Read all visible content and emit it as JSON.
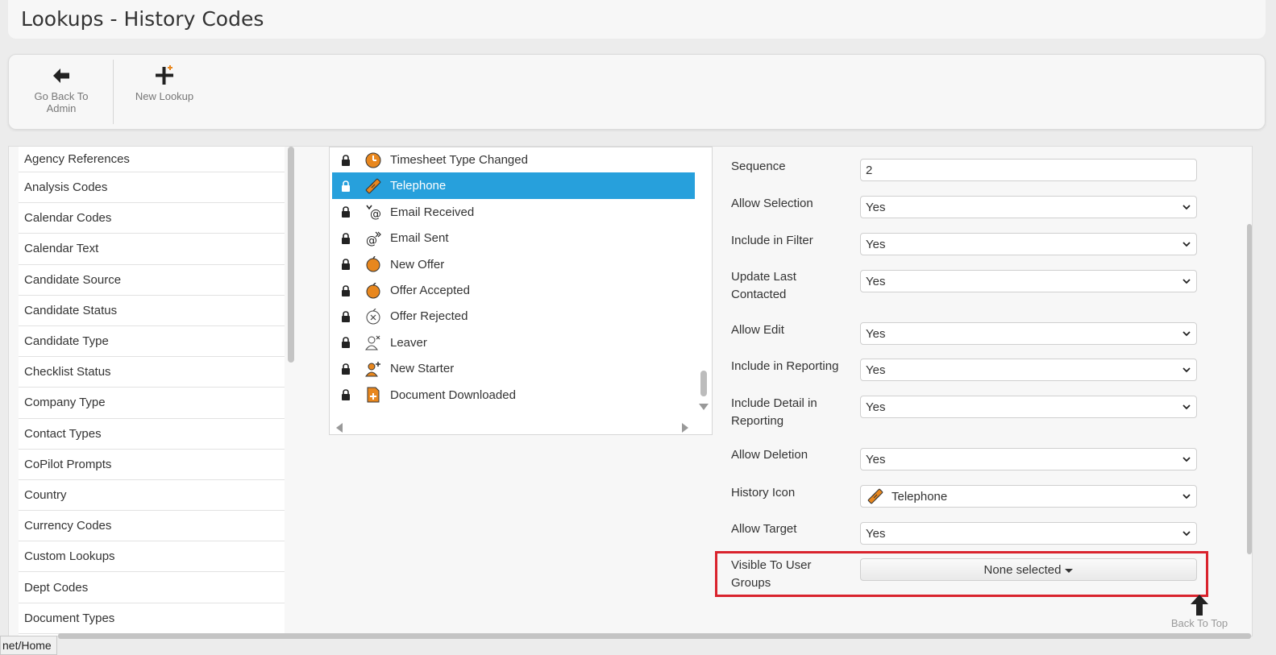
{
  "page_title": "Lookups - History Codes",
  "toolbar": {
    "back_label": "Go Back To Admin",
    "new_label": "New Lookup"
  },
  "lookup_list": [
    "Agency References",
    "Analysis Codes",
    "Calendar Codes",
    "Calendar Text",
    "Candidate Source",
    "Candidate Status",
    "Candidate Type",
    "Checklist Status",
    "Company Type",
    "Contact Types",
    "CoPilot Prompts",
    "Country",
    "Currency Codes",
    "Custom Lookups",
    "Dept Codes",
    "Document Types"
  ],
  "history_codes": [
    {
      "label": "Timesheet Type Changed",
      "icon": "clock-icon",
      "selected": false
    },
    {
      "label": "Telephone",
      "icon": "telephone-icon",
      "selected": true
    },
    {
      "label": "Email Received",
      "icon": "email-received-icon",
      "selected": false
    },
    {
      "label": "Email Sent",
      "icon": "email-sent-icon",
      "selected": false
    },
    {
      "label": "New Offer",
      "icon": "offer-icon",
      "selected": false
    },
    {
      "label": "Offer Accepted",
      "icon": "offer-accepted-icon",
      "selected": false
    },
    {
      "label": "Offer Rejected",
      "icon": "offer-rejected-icon",
      "selected": false
    },
    {
      "label": "Leaver",
      "icon": "leaver-icon",
      "selected": false
    },
    {
      "label": "New Starter",
      "icon": "new-starter-icon",
      "selected": false
    },
    {
      "label": "Document Downloaded",
      "icon": "document-downloaded-icon",
      "selected": false
    }
  ],
  "form": {
    "sequence": {
      "label": "Sequence",
      "value": "2"
    },
    "allow_selection": {
      "label": "Allow Selection",
      "value": "Yes"
    },
    "include_in_filter": {
      "label": "Include in Filter",
      "value": "Yes"
    },
    "update_last_contacted": {
      "label": "Update Last Contacted",
      "value": "Yes"
    },
    "allow_edit": {
      "label": "Allow Edit",
      "value": "Yes"
    },
    "include_in_reporting": {
      "label": "Include in Reporting",
      "value": "Yes"
    },
    "include_detail_in_reporting": {
      "label": "Include Detail in Reporting",
      "value": "Yes"
    },
    "allow_deletion": {
      "label": "Allow Deletion",
      "value": "Yes"
    },
    "history_icon": {
      "label": "History Icon",
      "value": "Telephone"
    },
    "allow_target": {
      "label": "Allow Target",
      "value": "Yes"
    },
    "visible_to_user_groups": {
      "label": "Visible To User Groups",
      "value": "None selected"
    }
  },
  "back_to_top_label": "Back To Top",
  "status_url": "net/Home",
  "colors": {
    "selected_row": "#27a0dc",
    "highlight_border": "#d9232d",
    "icon_orange": "#e8871e"
  }
}
